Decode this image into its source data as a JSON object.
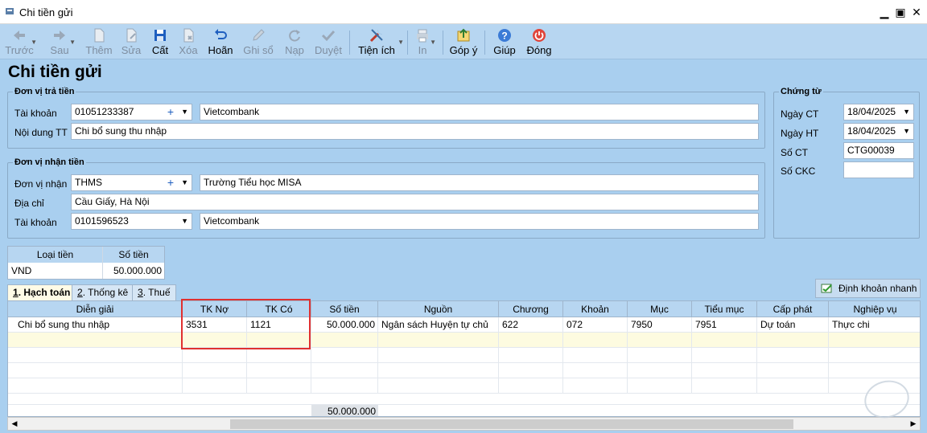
{
  "window": {
    "title": "Chi tiền gửi"
  },
  "toolbar": [
    {
      "key": "prev",
      "label": "Trước",
      "icon": "arrow-left-icon",
      "disabled": true
    },
    {
      "key": "next",
      "label": "Sau",
      "icon": "arrow-right-icon",
      "disabled": true
    },
    {
      "key": "add",
      "label": "Thêm",
      "icon": "new-document-icon",
      "disabled": true
    },
    {
      "key": "edit",
      "label": "Sửa",
      "icon": "edit-document-icon",
      "disabled": true
    },
    {
      "key": "save",
      "label": "Cất",
      "icon": "save-icon",
      "disabled": false
    },
    {
      "key": "delete",
      "label": "Xóa",
      "icon": "delete-icon",
      "disabled": true
    },
    {
      "key": "undo",
      "label": "Hoãn",
      "icon": "undo-icon",
      "disabled": false
    },
    {
      "key": "post",
      "label": "Ghi sổ",
      "icon": "pencil-icon",
      "disabled": true
    },
    {
      "key": "load",
      "label": "Nạp",
      "icon": "refresh-icon",
      "disabled": true
    },
    {
      "key": "approve",
      "label": "Duyệt",
      "icon": "checkmark-icon",
      "disabled": true
    },
    {
      "key": "utilities",
      "label": "Tiện ích",
      "icon": "tools-icon",
      "disabled": false
    },
    {
      "key": "print",
      "label": "In",
      "icon": "printer-icon",
      "disabled": true
    },
    {
      "key": "feedback",
      "label": "Góp ý",
      "icon": "feedback-icon",
      "disabled": false
    },
    {
      "key": "help",
      "label": "Giúp",
      "icon": "help-icon",
      "disabled": false
    },
    {
      "key": "close",
      "label": "Đóng",
      "icon": "power-icon",
      "disabled": false
    }
  ],
  "page_title": "Chi tiền gửi",
  "payer": {
    "legend": "Đơn vị trả tiền",
    "account_label": "Tài khoản",
    "account_value": "01051233387",
    "bank": "Vietcombank",
    "content_label": "Nội dung TT",
    "content_value": "Chi bổ sung thu nhập"
  },
  "payee": {
    "legend": "Đơn vị nhận tiền",
    "unit_label": "Đơn vị nhận",
    "unit_code": "THMS",
    "unit_name": "Trường Tiểu học MISA",
    "address_label": "Địa chỉ",
    "address_value": "Cầu Giấy, Hà Nội",
    "account_label": "Tài khoản",
    "account_value": "0101596523",
    "bank": "Vietcombank"
  },
  "voucher": {
    "legend": "Chứng từ",
    "date_ct_label": "Ngày CT",
    "date_ct": "18/04/2025",
    "date_ht_label": "Ngày HT",
    "date_ht": "18/04/2025",
    "no_label": "Số CT",
    "no_value": "CTG00039",
    "ckc_label": "Số CKC",
    "ckc_value": ""
  },
  "currency": {
    "headers": [
      "Loại tiền",
      "Số tiền"
    ],
    "row": [
      "VND",
      "50.000.000"
    ]
  },
  "tabs": [
    {
      "key": "1",
      "label": ". Hạch toán",
      "active": true
    },
    {
      "key": "2",
      "label": ". Thống kê",
      "active": false
    },
    {
      "key": "3",
      "label": ". Thuế",
      "active": false
    }
  ],
  "quick_entry_label": "Định khoản nhanh",
  "grid": {
    "headers": [
      "Diễn giải",
      "TK Nợ",
      "TK Có",
      "Số tiền",
      "Nguồn",
      "Chương",
      "Khoản",
      "Mục",
      "Tiểu mục",
      "Cấp phát",
      "Nghiệp vụ"
    ],
    "rows": [
      [
        "Chi bổ sung thu nhập",
        "3531",
        "1121",
        "50.000.000",
        "Ngân sách Huyện tự chủ",
        "622",
        "072",
        "7950",
        "7951",
        "Dự toán",
        "Thực chi"
      ]
    ],
    "total": "50.000.000"
  },
  "colors": {
    "background": "#a9cfef",
    "header": "#b7d6f1",
    "highlight_box": "#e03030"
  }
}
